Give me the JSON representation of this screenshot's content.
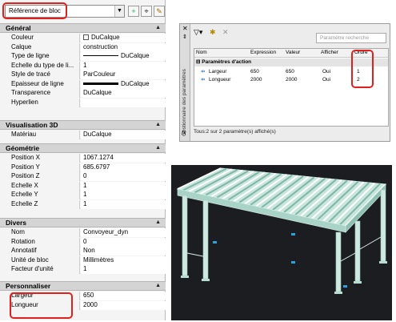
{
  "properties": {
    "selector_value": "Référence de bloc",
    "sections": [
      {
        "title": "Général",
        "rows": [
          {
            "label": "Couleur",
            "value": "DuCalque",
            "kind": "swatch"
          },
          {
            "label": "Calque",
            "value": "construction"
          },
          {
            "label": "Type de ligne",
            "value": "DuCalque",
            "kind": "line"
          },
          {
            "label": "Echelle du type de li...",
            "value": "1"
          },
          {
            "label": "Style de tracé",
            "value": "ParCouleur"
          },
          {
            "label": "Epaisseur de ligne",
            "value": "DuCalque",
            "kind": "thick"
          },
          {
            "label": "Transparence",
            "value": "DuCalque"
          },
          {
            "label": "Hyperlien",
            "value": ""
          }
        ]
      },
      {
        "title": "Visualisation 3D",
        "rows": [
          {
            "label": "Matériau",
            "value": "DuCalque"
          }
        ]
      },
      {
        "title": "Géométrie",
        "rows": [
          {
            "label": "Position X",
            "value": "1067.1274"
          },
          {
            "label": "Position Y",
            "value": "685.6797"
          },
          {
            "label": "Position Z",
            "value": "0"
          },
          {
            "label": "Echelle X",
            "value": "1"
          },
          {
            "label": "Echelle Y",
            "value": "1"
          },
          {
            "label": "Echelle Z",
            "value": "1"
          }
        ]
      },
      {
        "title": "Divers",
        "rows": [
          {
            "label": "Nom",
            "value": "Convoyeur_dyn"
          },
          {
            "label": "Rotation",
            "value": "0"
          },
          {
            "label": "Annotatif",
            "value": "Non"
          },
          {
            "label": "Unité de bloc",
            "value": "Millimètres"
          },
          {
            "label": "Facteur d'unité",
            "value": "1"
          }
        ]
      },
      {
        "title": "Personnaliser",
        "rows": [
          {
            "label": "Largeur",
            "value": "650"
          },
          {
            "label": "Longueur",
            "value": "2000"
          }
        ]
      }
    ]
  },
  "param_manager": {
    "side_title": "Gestionnaire des paramètres",
    "search_placeholder": "Paramètre recherche",
    "columns": [
      "Nom",
      "Expression",
      "Valeur",
      "Afficher",
      "Ordre"
    ],
    "group": "Paramètres d'action",
    "rows": [
      {
        "name": "Largeur",
        "expression": "650",
        "value": "650",
        "show": "Oui",
        "order": "1"
      },
      {
        "name": "Longueur",
        "expression": "2000",
        "value": "2000",
        "show": "Oui",
        "order": "2"
      }
    ],
    "status": "Tous:2 sur 2 paramètre(s) affiché(s)"
  },
  "colors": {
    "highlight": "#e0201d",
    "viewport_bg": "#1b1d21",
    "structure": "#d9efe6"
  }
}
